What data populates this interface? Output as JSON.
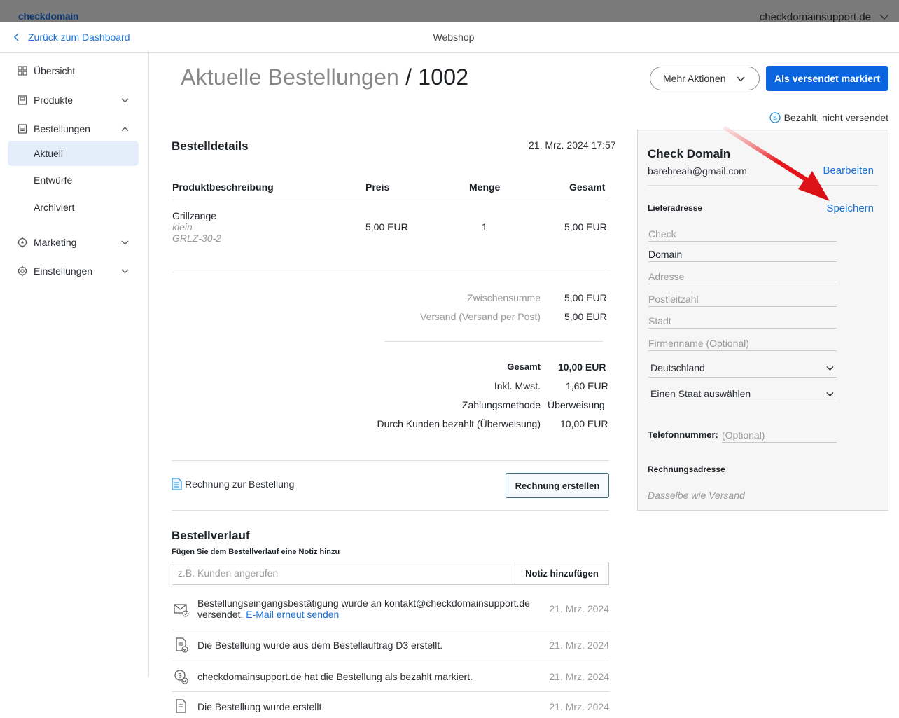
{
  "topbar": {
    "logo": "checkdomain",
    "account": "checkdomainsupport.de"
  },
  "header": {
    "back_label": "Zurück zum Dashboard",
    "page_name": "Webshop"
  },
  "sidebar": {
    "items": [
      {
        "label": "Übersicht"
      },
      {
        "label": "Produkte"
      },
      {
        "label": "Bestellungen"
      },
      {
        "label": "Aktuell"
      },
      {
        "label": "Entwürfe"
      },
      {
        "label": "Archiviert"
      },
      {
        "label": "Marketing"
      },
      {
        "label": "Einstellungen"
      }
    ]
  },
  "page": {
    "title_prefix": "Aktuelle Bestellungen",
    "title_sep": "/",
    "order_number": "1002",
    "more_actions": "Mehr Aktionen",
    "mark_shipped": "Als versendet markiert",
    "status": "Bezahlt, nicht versendet"
  },
  "details": {
    "title": "Bestelldetails",
    "date": "21. Mrz. 2024 17:57",
    "columns": [
      "Produktbeschreibung",
      "Preis",
      "Menge",
      "Gesamt"
    ],
    "item": {
      "name": "Grillzange",
      "variant": "klein",
      "sku": "GRLZ-30-2",
      "price": "5,00 EUR",
      "qty": "1",
      "total": "5,00 EUR"
    },
    "subtotal_label": "Zwischensumme",
    "subtotal": "5,00 EUR",
    "shipping_label": "Versand (Versand per Post)",
    "shipping": "5,00 EUR",
    "total_label": "Gesamt",
    "total": "10,00 EUR",
    "tax_label": "Inkl. Mwst.",
    "tax": "1,60 EUR",
    "payment_label": "Zahlungsmethode",
    "payment": "Überweisung",
    "paid_label": "Durch Kunden bezahlt (Überweisung)",
    "paid": "10,00 EUR",
    "invoice_label": "Rechnung zur Bestellung",
    "invoice_button": "Rechnung erstellen"
  },
  "history": {
    "title": "Bestellverlauf",
    "note_label": "Fügen Sie dem Bestellverlauf eine Notiz hinzu",
    "note_placeholder": "z.B. Kunden angerufen",
    "note_button": "Notiz hinzufügen",
    "entries": [
      {
        "line1": "Bestellungseingangsbestätigung wurde an kontakt@checkdomainsupport.de",
        "line2": "versendet.",
        "link": "E-Mail erneut senden",
        "date": "21. Mrz. 2024"
      },
      {
        "text": "Die Bestellung wurde aus dem Bestellauftrag D3 erstellt.",
        "date": "21. Mrz. 2024"
      },
      {
        "text": "checkdomainsupport.de hat die Bestellung als bezahlt markiert.",
        "date": "21. Mrz. 2024"
      },
      {
        "text": "Die Bestellung wurde erstellt",
        "date": "21. Mrz. 2024"
      }
    ]
  },
  "customer": {
    "name": "Check Domain",
    "email": "barehreah@gmail.com",
    "edit": "Bearbeiten",
    "shipping_title": "Lieferadresse",
    "save": "Speichern",
    "first_name": "Check",
    "last_name": "Domain",
    "address_placeholder": "Adresse",
    "zip_placeholder": "Postleitzahl",
    "city_placeholder": "Stadt",
    "company_placeholder": "Firmenname (Optional)",
    "country": "Deutschland",
    "state": "Einen Staat auswählen",
    "phone_label": "Telefonnummer:",
    "phone_placeholder": "(Optional)",
    "billing_title": "Rechnungsadresse",
    "billing_value": "Dasselbe wie Versand"
  },
  "colors": {
    "accent": "#0a64e0",
    "link": "#1a73d8",
    "annotation_arrow": "#e8161c"
  }
}
